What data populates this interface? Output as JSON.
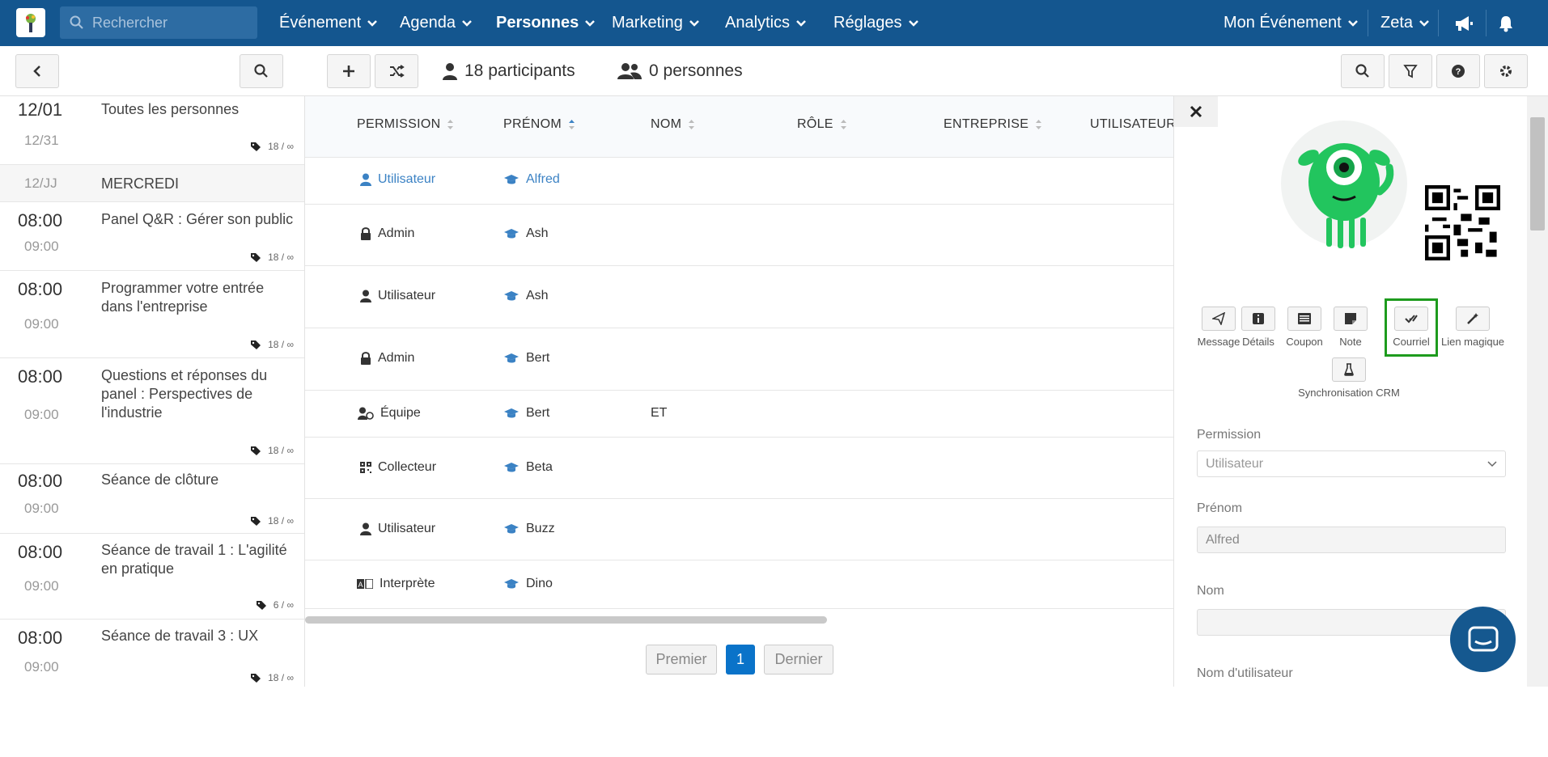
{
  "topbar": {
    "search_placeholder": "Rechercher",
    "nav": [
      "Événement",
      "Agenda",
      "Personnes",
      "Marketing",
      "Analytics",
      "Réglages"
    ],
    "event_selector": "Mon Événement",
    "user": "Zeta"
  },
  "toolbar": {
    "participants": "18 participants",
    "persons": "0 personnes"
  },
  "sessions": [
    {
      "start": "12/01",
      "end": "12/31",
      "title": "Toutes les personnes",
      "capacity": "18",
      "max": "∞"
    },
    {
      "start": "12/JJ",
      "end": "",
      "title": "MERCREDI",
      "capacity": "",
      "max": ""
    },
    {
      "start": "08:00",
      "end": "09:00",
      "title": "Panel Q&R : Gérer son public",
      "capacity": "18",
      "max": "∞"
    },
    {
      "start": "08:00",
      "end": "09:00",
      "title": "Programmer votre entrée dans l'entreprise",
      "capacity": "18",
      "max": "∞"
    },
    {
      "start": "08:00",
      "end": "09:00",
      "title": "Questions et réponses du panel : Perspectives de l'industrie",
      "capacity": "18",
      "max": "∞"
    },
    {
      "start": "08:00",
      "end": "09:00",
      "title": "Séance de clôture",
      "capacity": "18",
      "max": "∞"
    },
    {
      "start": "08:00",
      "end": "09:00",
      "title": "Séance de travail 1 : L'agilité en pratique",
      "capacity": "6",
      "max": "∞"
    },
    {
      "start": "08:00",
      "end": "09:00",
      "title": "Séance de travail 3 : UX",
      "capacity": "18",
      "max": "∞"
    }
  ],
  "table": {
    "headers": [
      "PERMISSION",
      "PRÉNOM",
      "NOM",
      "RÔLE",
      "ENTREPRISE",
      "UTILISATEUR"
    ],
    "rows": [
      {
        "permission": "Utilisateur",
        "icon": "user-icon",
        "first": "Alfred",
        "last": ""
      },
      {
        "permission": "Admin",
        "icon": "lock-icon",
        "first": "Ash",
        "last": ""
      },
      {
        "permission": "Utilisateur",
        "icon": "user-icon",
        "first": "Ash",
        "last": ""
      },
      {
        "permission": "Admin",
        "icon": "lock-icon",
        "first": "Bert",
        "last": ""
      },
      {
        "permission": "Équipe",
        "icon": "team-icon",
        "first": "Bert",
        "last": "ET"
      },
      {
        "permission": "Collecteur",
        "icon": "qr-icon",
        "first": "Beta",
        "last": ""
      },
      {
        "permission": "Utilisateur",
        "icon": "user-icon",
        "first": "Buzz",
        "last": ""
      },
      {
        "permission": "Interprète",
        "icon": "translate-icon",
        "first": "Dino",
        "last": ""
      }
    ]
  },
  "pagination": {
    "first": "Premier",
    "current": "1",
    "last": "Dernier"
  },
  "panel": {
    "actions": [
      "Message",
      "Détails",
      "Coupon",
      "Note",
      "Courriel",
      "Lien magique"
    ],
    "crm": "Synchronisation CRM",
    "fields": {
      "permission_label": "Permission",
      "permission_value": "Utilisateur",
      "first_label": "Prénom",
      "first_value": "Alfred",
      "last_label": "Nom",
      "last_value": "",
      "username_label": "Nom d'utilisateur"
    }
  },
  "colors": {
    "brand": "#14568f",
    "link": "#3b82c4",
    "highlight": "#1e9b1e"
  }
}
